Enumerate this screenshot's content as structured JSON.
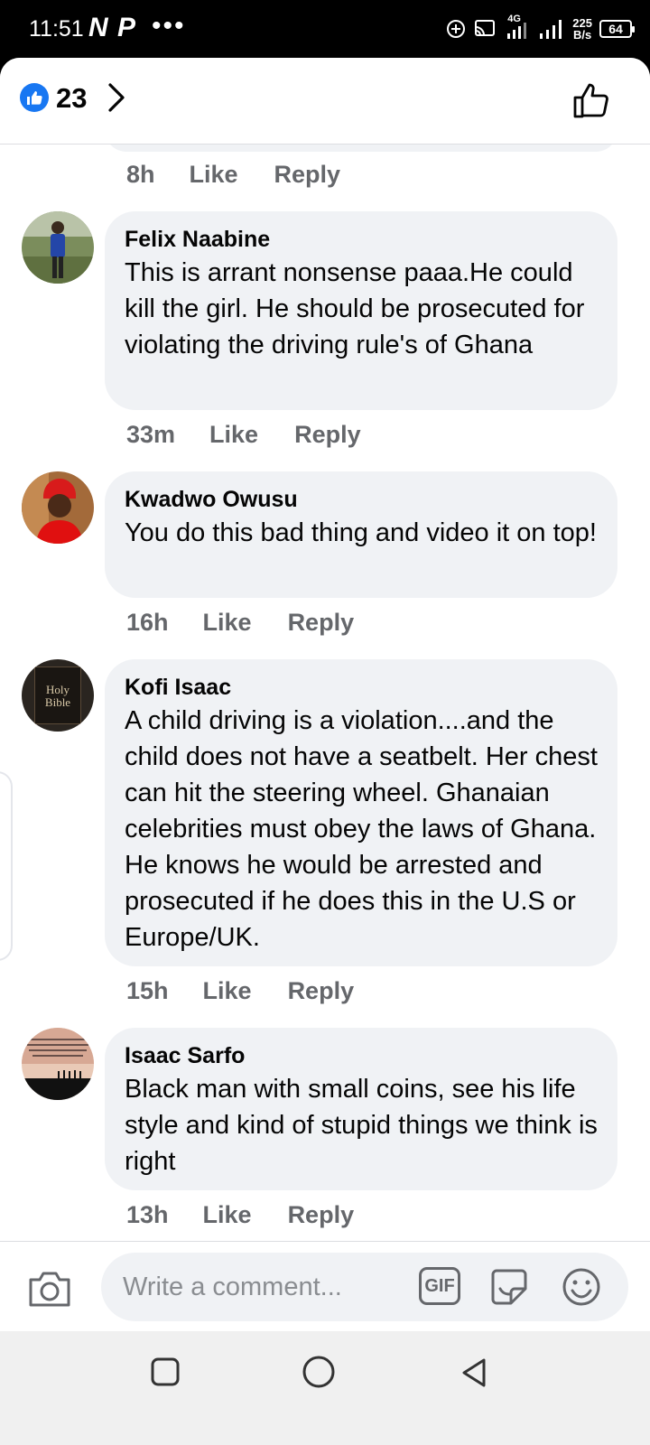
{
  "status_bar": {
    "time": "11:51",
    "carrier_badge": "N P",
    "more": "•••",
    "network": "4G",
    "speed_value": "225",
    "speed_unit": "B/s",
    "battery": "64"
  },
  "header": {
    "like_count": "23"
  },
  "previous_comment": {
    "time": "8h",
    "like_label": "Like",
    "reply_label": "Reply"
  },
  "comments": [
    {
      "author": "Felix Naabine",
      "text": "This is arrant nonsense paaa.He could kill the girl. He should be prosecuted for violating the driving rule's of Ghana",
      "time": "33m",
      "like_label": "Like",
      "reply_label": "Reply"
    },
    {
      "author": "Kwadwo Owusu",
      "text": "You do this bad thing and video it on top!",
      "time": "16h",
      "like_label": "Like",
      "reply_label": "Reply"
    },
    {
      "author": "Kofi Isaac",
      "text": "A child driving is a violation....and the child does not have a seatbelt. Her chest can hit the steering wheel. Ghanaian celebrities must obey the laws of Ghana. He knows he would be arrested and prosecuted if he does this in the U.S or Europe/UK.",
      "avatar_text_1": "Holy",
      "avatar_text_2": "Bible",
      "time": "15h",
      "like_label": "Like",
      "reply_label": "Reply"
    },
    {
      "author": "Isaac Sarfo",
      "text": "Black man with small coins, see his life style and kind of stupid things we think is right",
      "time": "13h",
      "like_label": "Like",
      "reply_label": "Reply"
    }
  ],
  "composer": {
    "placeholder": "Write a comment...",
    "gif_label": "GIF"
  },
  "colors": {
    "accent": "#1877f2",
    "bubble": "#f0f2f5",
    "meta_text": "#65676b"
  },
  "icons": [
    "like-badge-icon",
    "chevron-right-icon",
    "thumbs-up-icon",
    "camera-icon",
    "gif-icon",
    "sticker-icon",
    "emoji-icon",
    "nav-recents-icon",
    "nav-home-icon",
    "nav-back-icon"
  ]
}
